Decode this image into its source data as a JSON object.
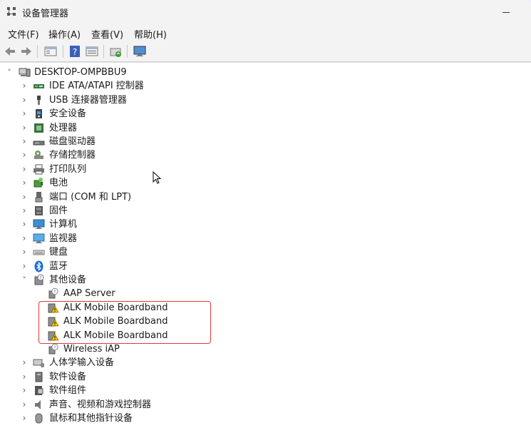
{
  "window": {
    "title": "设备管理器"
  },
  "menu": [
    "文件(F)",
    "操作(A)",
    "查看(V)",
    "帮助(H)"
  ],
  "tree": {
    "root": "DESKTOP-OMPBBU9",
    "categories": [
      {
        "label": "IDE ATA/ATAPI 控制器",
        "icon": "ide-controller-icon"
      },
      {
        "label": "USB 连接器管理器",
        "icon": "usb-icon"
      },
      {
        "label": "安全设备",
        "icon": "security-device-icon"
      },
      {
        "label": "处理器",
        "icon": "processor-icon"
      },
      {
        "label": "磁盘驱动器",
        "icon": "disk-drive-icon"
      },
      {
        "label": "存储控制器",
        "icon": "storage-controller-icon"
      },
      {
        "label": "打印队列",
        "icon": "printer-icon"
      },
      {
        "label": "电池",
        "icon": "battery-icon"
      },
      {
        "label": "端口 (COM 和 LPT)",
        "icon": "port-icon"
      },
      {
        "label": "固件",
        "icon": "firmware-icon"
      },
      {
        "label": "计算机",
        "icon": "computer-icon"
      },
      {
        "label": "监视器",
        "icon": "monitor-icon"
      },
      {
        "label": "键盘",
        "icon": "keyboard-icon"
      },
      {
        "label": "蓝牙",
        "icon": "bluetooth-icon"
      }
    ],
    "other_devices": {
      "label": "其他设备",
      "children": [
        {
          "label": "AAP Server",
          "icon": "unknown-device-icon"
        },
        {
          "label": "ALK Mobile Boardband",
          "icon": "warning-device-icon"
        },
        {
          "label": "ALK Mobile Boardband",
          "icon": "warning-device-icon"
        },
        {
          "label": "ALK Mobile Boardband",
          "icon": "warning-device-icon"
        },
        {
          "label": "Wireless iAP",
          "icon": "unknown-device-icon"
        }
      ]
    },
    "more_categories": [
      {
        "label": "人体学输入设备",
        "icon": "hid-icon"
      },
      {
        "label": "软件设备",
        "icon": "software-device-icon"
      },
      {
        "label": "软件组件",
        "icon": "software-component-icon"
      },
      {
        "label": "声音、视频和游戏控制器",
        "icon": "sound-icon"
      },
      {
        "label": "鼠标和其他指针设备",
        "icon": "mouse-icon"
      }
    ]
  },
  "colors": {
    "highlight": "#e03a3a",
    "window_bg": "#f3f3f3",
    "content_bg": "#ffffff"
  }
}
